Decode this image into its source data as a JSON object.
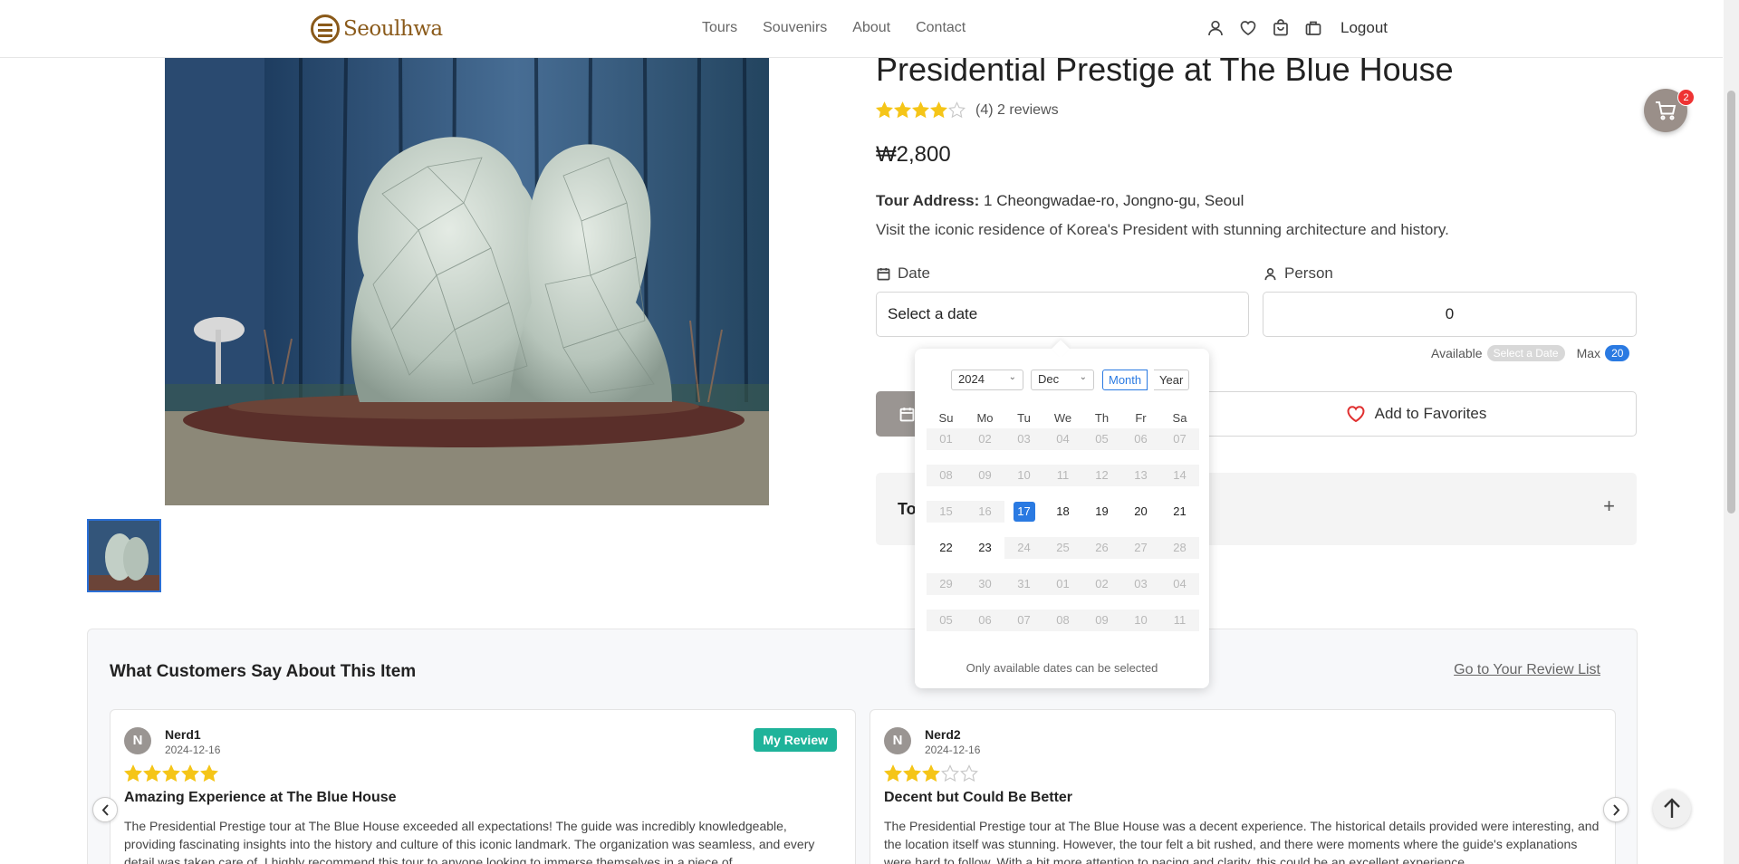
{
  "header": {
    "brand": "Seoulhwa",
    "nav": [
      "Tours",
      "Souvenirs",
      "About",
      "Contact"
    ],
    "icons": [
      "user-icon",
      "heart-icon",
      "bag-icon",
      "suitcase-icon"
    ],
    "logout": "Logout"
  },
  "product": {
    "title": "Presidential Prestige at The Blue House",
    "rating": 4,
    "rating_count": "(4)",
    "reviews_count": "2 reviews",
    "price": "₩2,800",
    "address_label": "Tour Address:",
    "address": "1 Cheongwadae-ro, Jongno-gu, Seoul",
    "description": "Visit the iconic residence of Korea's President with stunning architecture and history."
  },
  "booking": {
    "date_label": "Date",
    "date_placeholder": "Select a date",
    "person_label": "Person",
    "person_value": "0",
    "available_label": "Available",
    "available_value": "Select a Date",
    "max_label": "Max",
    "max_value": "20",
    "favorite_label": "Add to Favorites",
    "accordion_title": "To",
    "accordion_icon": "+"
  },
  "datepicker": {
    "year": "2024",
    "month": "Dec",
    "view_month": "Month",
    "view_year": "Year",
    "weekdays": [
      "Su",
      "Mo",
      "Tu",
      "We",
      "Th",
      "Fr",
      "Sa"
    ],
    "weeks": [
      [
        [
          "01",
          "d"
        ],
        [
          "02",
          "d"
        ],
        [
          "03",
          "d"
        ],
        [
          "04",
          "d"
        ],
        [
          "05",
          "d"
        ],
        [
          "06",
          "d"
        ],
        [
          "07",
          "d"
        ]
      ],
      [
        [
          "08",
          "d"
        ],
        [
          "09",
          "d"
        ],
        [
          "10",
          "d"
        ],
        [
          "11",
          "d"
        ],
        [
          "12",
          "d"
        ],
        [
          "13",
          "d"
        ],
        [
          "14",
          "d"
        ]
      ],
      [
        [
          "15",
          "d"
        ],
        [
          "16",
          "d"
        ],
        [
          "17",
          "s"
        ],
        [
          "18",
          "e"
        ],
        [
          "19",
          "e"
        ],
        [
          "20",
          "e"
        ],
        [
          "21",
          "e"
        ]
      ],
      [
        [
          "22",
          "e"
        ],
        [
          "23",
          "e"
        ],
        [
          "24",
          "d"
        ],
        [
          "25",
          "d"
        ],
        [
          "26",
          "d"
        ],
        [
          "27",
          "d"
        ],
        [
          "28",
          "d"
        ]
      ],
      [
        [
          "29",
          "d"
        ],
        [
          "30",
          "d"
        ],
        [
          "31",
          "d"
        ],
        [
          "01",
          "d"
        ],
        [
          "02",
          "d"
        ],
        [
          "03",
          "d"
        ],
        [
          "04",
          "d"
        ]
      ],
      [
        [
          "05",
          "d"
        ],
        [
          "06",
          "d"
        ],
        [
          "07",
          "d"
        ],
        [
          "08",
          "d"
        ],
        [
          "09",
          "d"
        ],
        [
          "10",
          "d"
        ],
        [
          "11",
          "d"
        ]
      ]
    ],
    "note": "Only available dates can be selected"
  },
  "floating": {
    "cart_badge": "2"
  },
  "reviews": {
    "title": "What Customers Say About This Item",
    "link": "Go to Your Review List",
    "items": [
      {
        "initial": "N",
        "name": "Nerd1",
        "date": "2024-12-16",
        "stars": 5,
        "badge": "My Review",
        "title": "Amazing Experience at The Blue House",
        "body": "The Presidential Prestige tour at The Blue House exceeded all expectations! The guide was incredibly knowledgeable, providing fascinating insights into the history and culture of this iconic landmark. The organization was seamless, and every detail was taken care of. I highly recommend this tour to anyone looking to immerse themselves in a piece of"
      },
      {
        "initial": "N",
        "name": "Nerd2",
        "date": "2024-12-16",
        "stars": 3,
        "badge": "",
        "title": "Decent but Could Be Better",
        "body": "The Presidential Prestige tour at The Blue House was a decent experience. The historical details provided were interesting, and the location itself was stunning. However, the tour felt a bit rushed, and there were moments where the guide's explanations were hard to follow. With a bit more attention to pacing and clarity, this could be an excellent experience."
      }
    ]
  },
  "colors": {
    "brand": "#8a5a1a",
    "accent": "#2a7ae2",
    "star": "#f5c518",
    "badge": "#1fb39a"
  }
}
